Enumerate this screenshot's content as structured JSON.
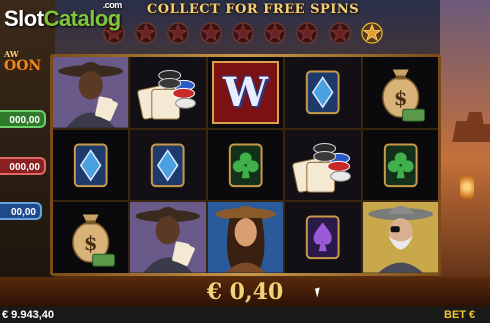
{
  "watermark": {
    "part1": "Slot",
    "part2": "Catalog",
    "suffix": ".com"
  },
  "logo": {
    "line1": "AW",
    "line2": "OON"
  },
  "header": {
    "title": "COLLECT FOR FREE SPINS"
  },
  "collector": {
    "stars_total": 9,
    "stars_lit": 1
  },
  "jackpots": [
    {
      "value": "000,00"
    },
    {
      "value": "000,00"
    },
    {
      "value": "00,00"
    }
  ],
  "reels": [
    [
      "cowboy-black-cards",
      "poker-chips-cards",
      "wild-w",
      "diamond-card",
      "money-bag-dollar"
    ],
    [
      "diamond-card",
      "diamond-card",
      "club-card",
      "poker-chips-cards",
      "club-card"
    ],
    [
      "money-bag-dollar",
      "cowboy-black-cards",
      "cowgirl",
      "spade-card",
      "old-cowboy-eyepatch"
    ]
  ],
  "wild_symbol_text": "W",
  "win": {
    "display": "€ 0,40"
  },
  "footer": {
    "balance": "€ 9.943,40",
    "bet_label": "BET €"
  }
}
